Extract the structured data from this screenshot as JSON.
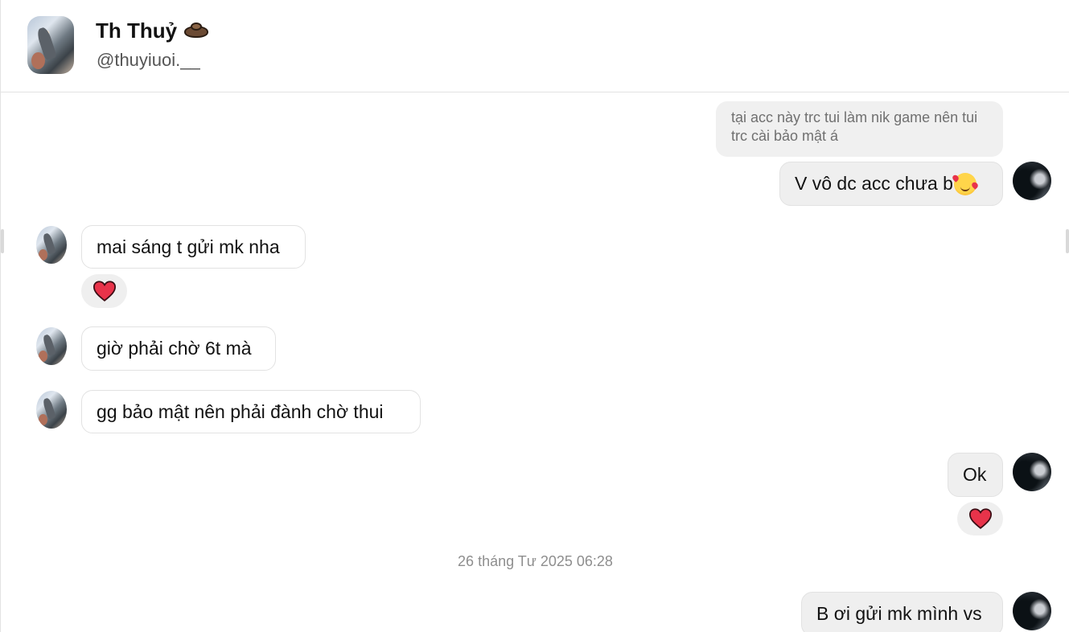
{
  "header": {
    "name": "Th Thuỷ",
    "name_emoji": "otter-emoji",
    "handle": "@thuyiuoi.__"
  },
  "messages": [
    {
      "id": "reply_quote",
      "sender": "me",
      "text": "tại acc này trc tui làm nik game nên tui trc cài bảo mật á",
      "kind": "quoted-reply"
    },
    {
      "id": "m1",
      "sender": "me",
      "text": "V vô dc acc chưa b",
      "emoji": "smiling-face-with-hearts"
    },
    {
      "id": "m2",
      "sender": "them",
      "text": "mai sáng t gửi mk nha",
      "reaction": "❤️"
    },
    {
      "id": "m3",
      "sender": "them",
      "text": "giờ phải chờ 6t mà"
    },
    {
      "id": "m4",
      "sender": "them",
      "text": "gg bảo mật nên phải đành chờ thui"
    },
    {
      "id": "m5",
      "sender": "me",
      "text": "Ok",
      "reaction": "❤️"
    },
    {
      "id": "m6",
      "sender": "me",
      "text": "B ơi gửi mk mình vs"
    }
  ],
  "timestamp": "26 tháng Tư 2025 06:28",
  "colors": {
    "heart": "#e8334a",
    "bubble_mine_bg": "#efefef",
    "bubble_border": "#e2e2e2",
    "timestamp": "#8e8e8e"
  }
}
